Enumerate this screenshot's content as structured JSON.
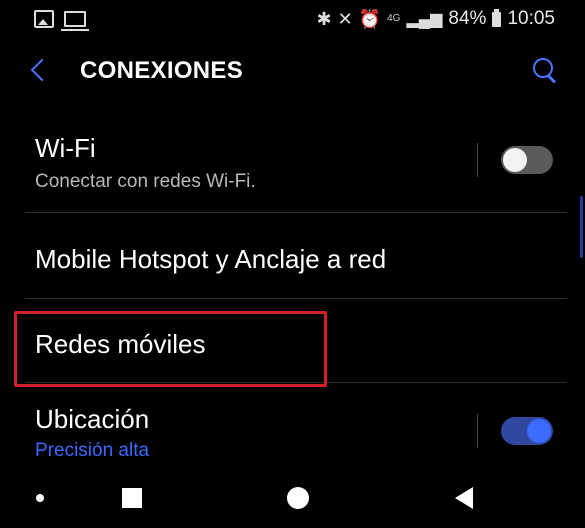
{
  "status_bar": {
    "battery": "84%",
    "time": "10:05",
    "network": "4G"
  },
  "header": {
    "title": "CONEXIONES"
  },
  "settings": {
    "wifi": {
      "title": "Wi-Fi",
      "subtitle": "Conectar con redes Wi-Fi.",
      "enabled": false
    },
    "hotspot": {
      "title": "Mobile Hotspot y Anclaje a red"
    },
    "mobile_networks": {
      "title": "Redes móviles"
    },
    "location": {
      "title": "Ubicación",
      "subtitle": "Precisión alta",
      "enabled": true
    }
  },
  "colors": {
    "accent": "#3d6bff",
    "highlight": "#d0202a",
    "background": "#000000"
  },
  "icons": [
    "image-icon",
    "laptop-icon",
    "bluetooth-icon",
    "mute-icon",
    "alarm-icon",
    "signal-icon",
    "battery-icon",
    "back-arrow-icon",
    "search-icon"
  ]
}
